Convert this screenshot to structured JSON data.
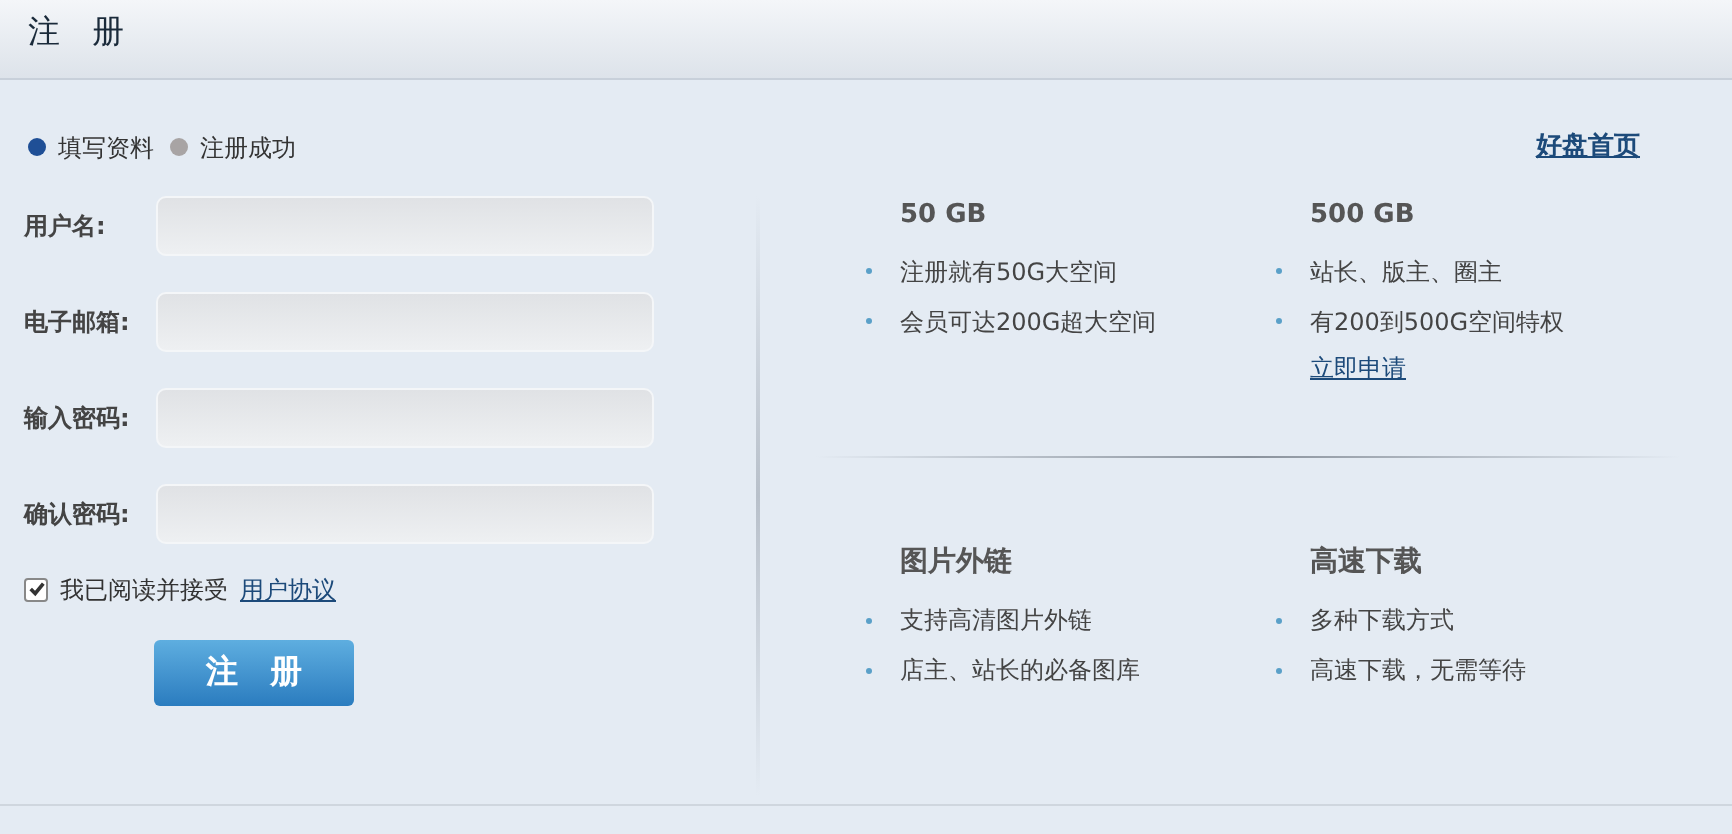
{
  "header": {
    "title": "注　册"
  },
  "steps": [
    {
      "label": "填写资料",
      "selected": true
    },
    {
      "label": "注册成功",
      "selected": false
    }
  ],
  "home_link": "好盘首页",
  "form": {
    "fields": [
      {
        "label": "用户名:"
      },
      {
        "label": "电子邮箱:"
      },
      {
        "label": "输入密码:"
      },
      {
        "label": "确认密码:"
      }
    ],
    "agreement": {
      "text": "我已阅读并接受",
      "link": "用户协议",
      "checked": true
    },
    "submit": "注　册"
  },
  "features": [
    {
      "title": "50 GB",
      "bullets": [
        "注册就有50G大空间",
        "会员可达200G超大空间"
      ]
    },
    {
      "title": "500 GB",
      "bullets": [
        "站长、版主、圈主",
        "有200到500G空间特权"
      ],
      "link": "立即申请"
    },
    {
      "title": "图片外链",
      "bullets": [
        "支持高清图片外链",
        "店主、站长的必备图库"
      ]
    },
    {
      "title": "高速下载",
      "bullets": [
        "多种下载方式",
        "高速下载，无需等待"
      ]
    }
  ]
}
